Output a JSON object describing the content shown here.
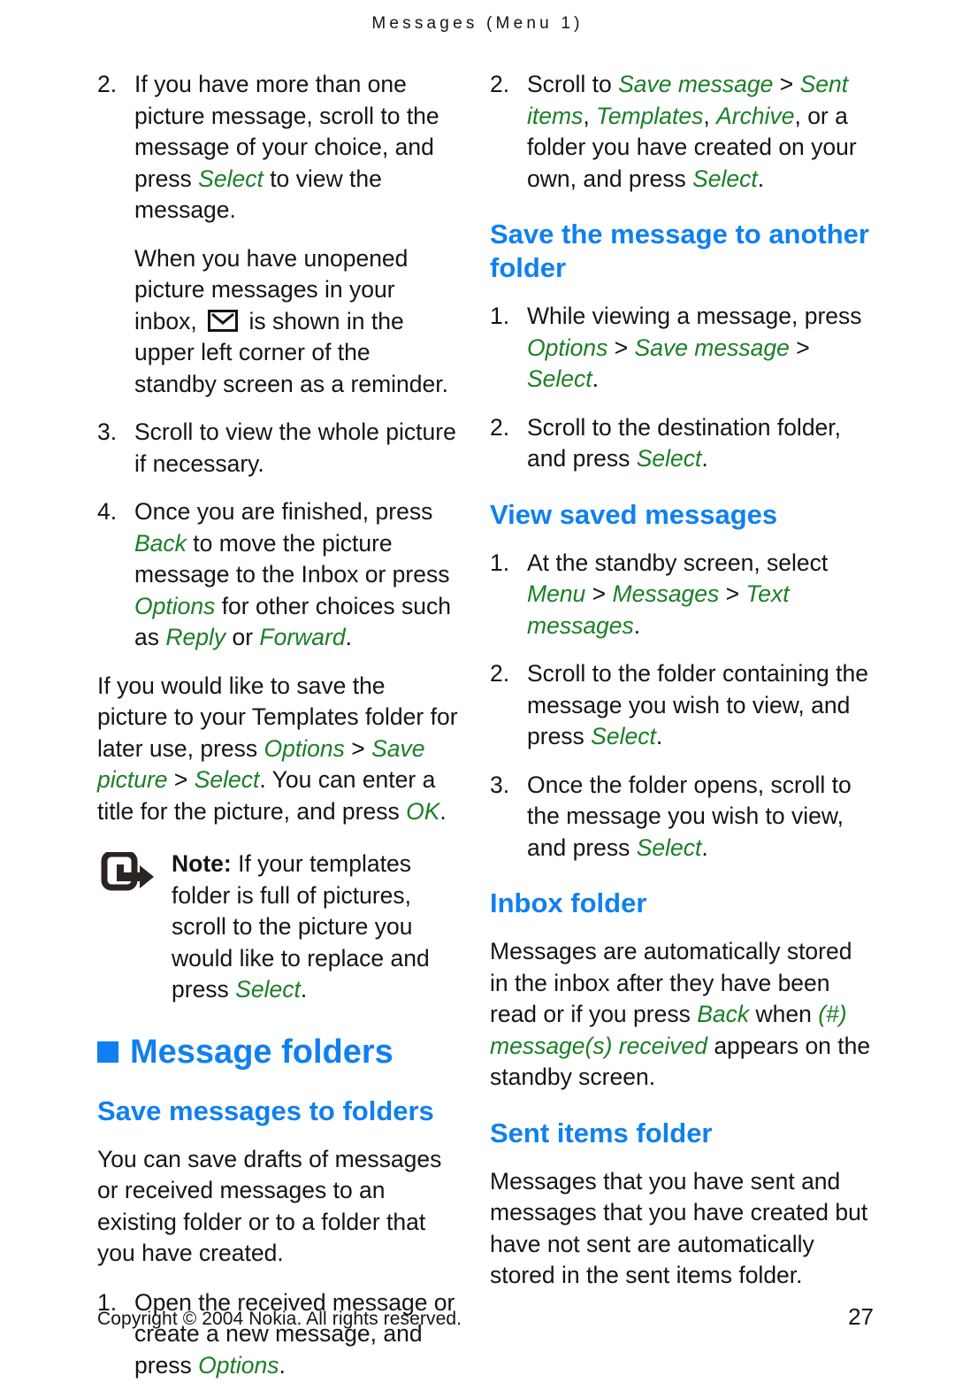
{
  "header": {
    "running_title": "Messages (Menu 1)"
  },
  "left_column": {
    "step2": {
      "num": "2.",
      "t1": "If you have more than one picture message, scroll to the message of your choice, and press ",
      "ui1": "Select",
      "t2": " to view the message."
    },
    "step2_cont": {
      "t1": "When you have unopened picture messages in your inbox, ",
      "icon": "envelope-icon",
      "t2": " is shown in the upper left corner of the standby screen as a reminder."
    },
    "step3": {
      "num": "3.",
      "t1": "Scroll to view the whole picture if necessary."
    },
    "step4": {
      "num": "4.",
      "t1": "Once you are finished, press ",
      "ui1": "Back",
      "t2": " to move the picture message to the Inbox or press ",
      "ui2": "Options",
      "t3": " for other choices such as ",
      "ui3": "Reply",
      "t4": " or ",
      "ui4": "Forward",
      "t5": "."
    },
    "save_picture_para": {
      "t1": "If you would like to save the picture to your Templates folder for later use, press ",
      "ui1": "Options",
      "sep1": " > ",
      "ui2": "Save picture",
      "sep2": " > ",
      "ui3": "Select",
      "t2": ". You can enter a title for the picture, and press ",
      "ui4": "OK",
      "t3": "."
    },
    "note": {
      "icon": "note-arrow-icon",
      "label": "Note:",
      "t1": " If your templates folder is full of pictures, scroll to the picture you would like to replace and press ",
      "ui1": "Select",
      "t2": "."
    },
    "chapter_heading": "Message folders",
    "section_save_messages": "Save messages to folders",
    "save_messages_para": "You can save drafts of messages or received messages to an existing folder or to a folder that you have created.",
    "save_step1": {
      "num": "1.",
      "t1": "Open the received message or create a new message, and press ",
      "ui1": "Options",
      "t2": "."
    }
  },
  "right_column": {
    "step2": {
      "num": "2.",
      "t1": "Scroll to ",
      "ui1": "Save message",
      "sep1": " > ",
      "ui2": "Sent items",
      "c1": ", ",
      "ui3": "Templates",
      "c2": ", ",
      "ui4": "Archive",
      "t2": ", or a folder you have created on your own, and press ",
      "ui5": "Select",
      "t3": "."
    },
    "section_save_another": "Save the message to another folder",
    "save_another_step1": {
      "num": "1.",
      "t1": "While viewing a message, press ",
      "ui1": "Options",
      "sep1": " > ",
      "ui2": "Save message",
      "sep2": " > ",
      "ui3": "Select",
      "t2": "."
    },
    "save_another_step2": {
      "num": "2.",
      "t1": "Scroll to the destination folder, and press ",
      "ui1": "Select",
      "t2": "."
    },
    "section_view_saved": "View saved messages",
    "view_step1": {
      "num": "1.",
      "t1": "At the standby screen, select ",
      "ui1": "Menu",
      "sep1": " > ",
      "ui2": "Messages",
      "sep2": " > ",
      "ui3": "Text messages",
      "t2": "."
    },
    "view_step2": {
      "num": "2.",
      "t1": "Scroll to the folder containing the message you wish to view, and press ",
      "ui1": "Select",
      "t2": "."
    },
    "view_step3": {
      "num": "3.",
      "t1": "Once the folder opens, scroll to the message you wish to view, and press ",
      "ui1": "Select",
      "t2": "."
    },
    "section_inbox": "Inbox folder",
    "inbox_para": {
      "t1": "Messages are automatically stored in the inbox after they have been read or if you press ",
      "ui1": "Back",
      "t2": " when ",
      "ui2": "(#) message(s) received",
      "t3": " appears on the standby screen."
    },
    "section_sent": "Sent items folder",
    "sent_para": "Messages that you have sent and messages that you have created but have not sent are automatically stored in the sent items folder."
  },
  "footer": {
    "copyright": "Copyright © 2004 Nokia. All rights reserved.",
    "page_number": "27"
  },
  "colors": {
    "heading_blue": "#1080f0",
    "ui_green": "#1a7f25",
    "body_text": "#151515"
  }
}
